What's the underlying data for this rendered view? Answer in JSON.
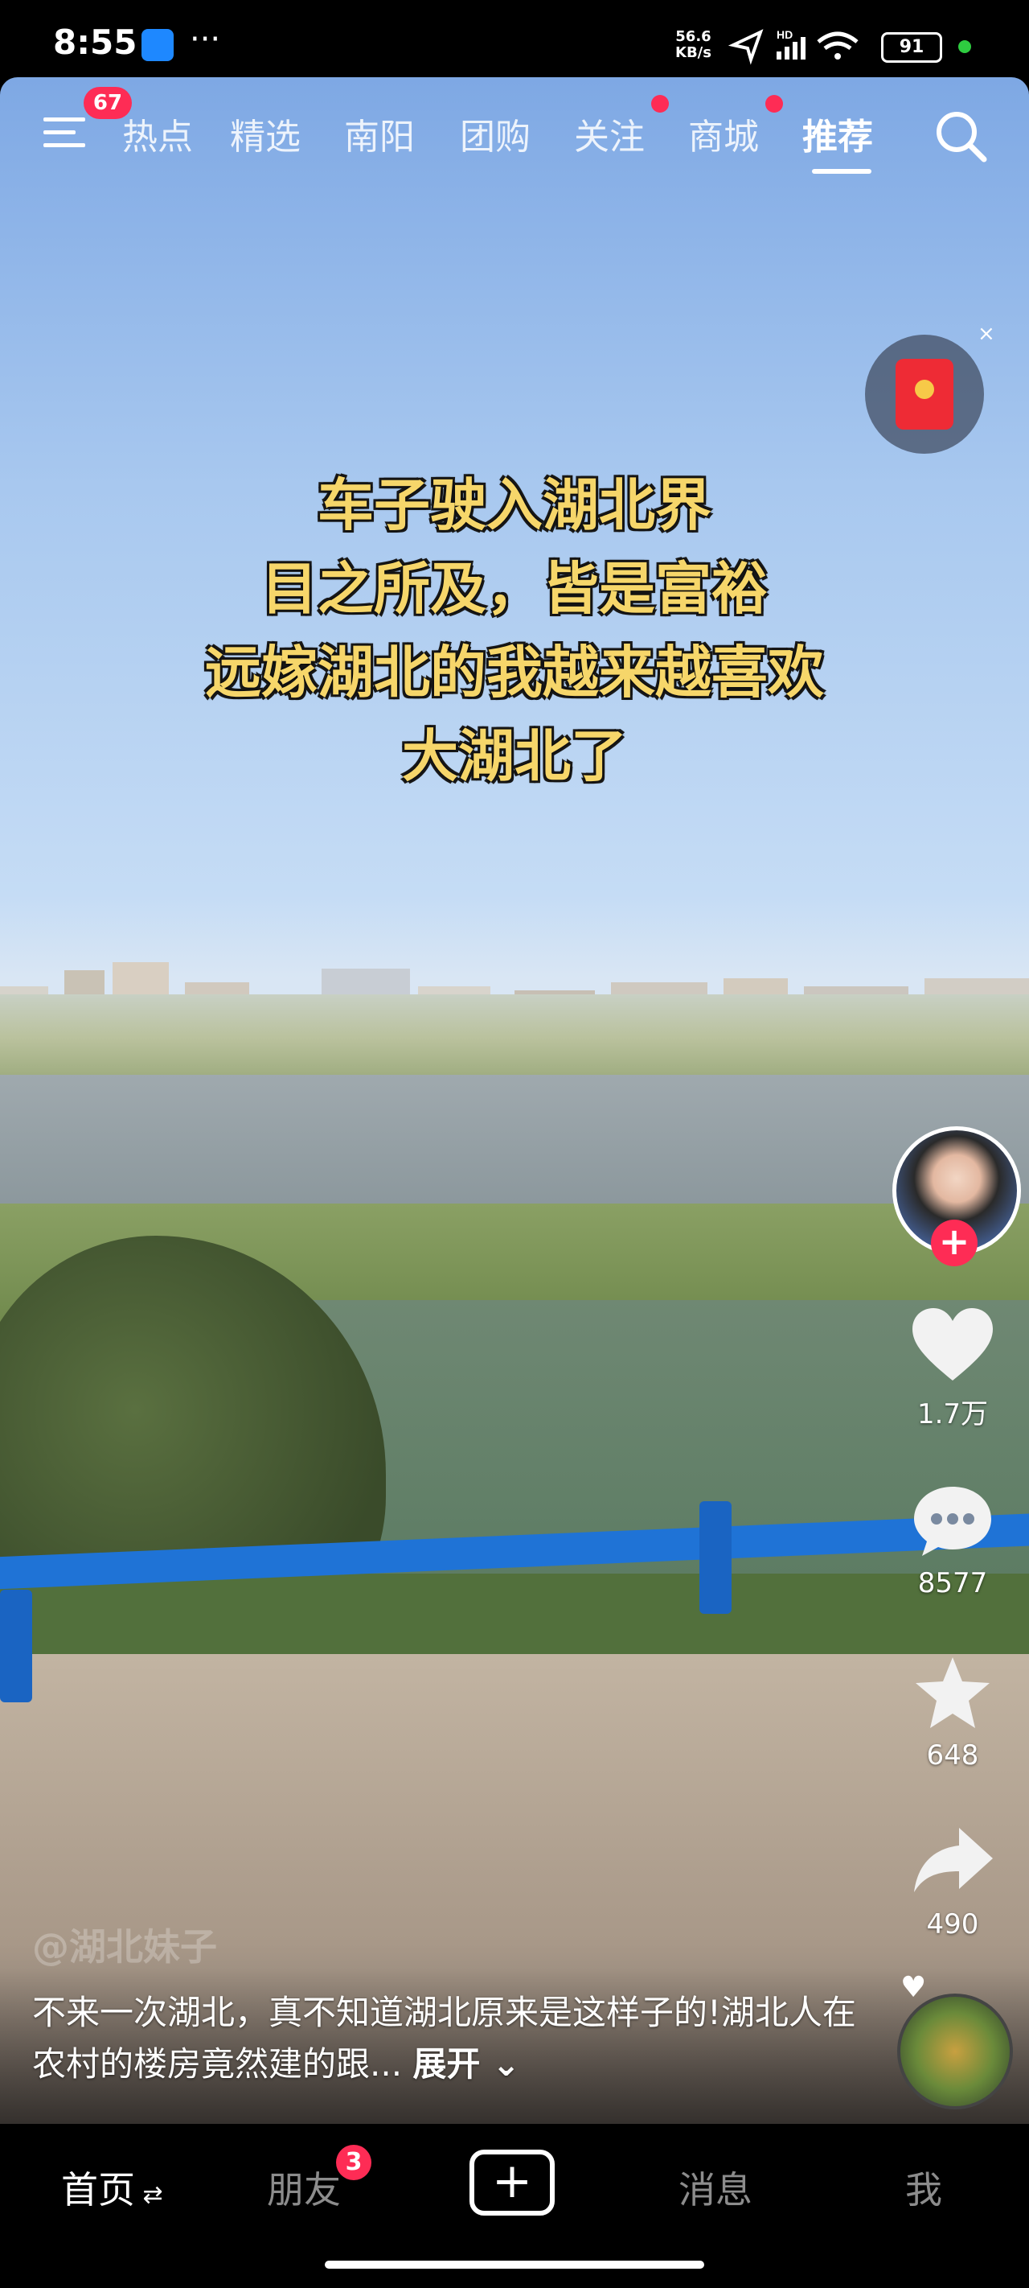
{
  "status_bar": {
    "time": "8:55",
    "net_speed_top": "56.6",
    "net_speed_bottom": "KB/s",
    "signal_label": "HD",
    "battery": "91",
    "icons": [
      "app-icon",
      "more-icon",
      "location-icon",
      "signal-icon",
      "wifi-icon",
      "battery-icon"
    ]
  },
  "top_nav": {
    "menu_badge": "67",
    "tabs": [
      {
        "label": "热点",
        "active": false,
        "dot": false
      },
      {
        "label": "精选",
        "active": false,
        "dot": false
      },
      {
        "label": "南阳",
        "active": false,
        "dot": false
      },
      {
        "label": "团购",
        "active": false,
        "dot": false
      },
      {
        "label": "关注",
        "active": false,
        "dot": true
      },
      {
        "label": "商城",
        "active": false,
        "dot": true
      },
      {
        "label": "推荐",
        "active": true,
        "dot": false
      }
    ],
    "search_icon": "search-icon"
  },
  "video": {
    "overlay_lines": [
      "车子驶入湖北界",
      "目之所及，皆是富裕",
      "远嫁湖北的我越来越喜欢",
      "大湖北了"
    ],
    "author": "@湖北妹子",
    "description": "不来一次湖北，真不知道湖北原来是这样子的!湖北人在农村的楼房竟然建的跟...",
    "expand_label": "展开"
  },
  "actions": {
    "likes": "1.7万",
    "comments": "8577",
    "favorites": "648",
    "shares": "490"
  },
  "red_packet": {
    "close": "×"
  },
  "bottom_nav": {
    "tabs": [
      {
        "label": "首页",
        "active": true
      },
      {
        "label": "朋友",
        "active": false,
        "badge": "3"
      },
      {
        "label": "消息",
        "active": false
      },
      {
        "label": "我",
        "active": false
      }
    ],
    "add_label": "+"
  },
  "colors": {
    "accent": "#fe2c55",
    "overlay_text": "#f6d66a",
    "rail": "#1f73d6"
  }
}
